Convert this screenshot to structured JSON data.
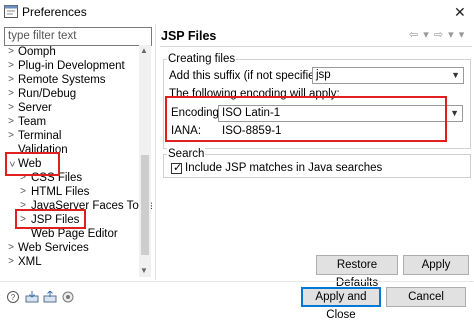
{
  "window": {
    "title": "Preferences"
  },
  "filter": {
    "placeholder": "type filter text"
  },
  "tree": {
    "items": [
      {
        "label": "Oomph"
      },
      {
        "label": "Plug-in Development"
      },
      {
        "label": "Remote Systems"
      },
      {
        "label": "Run/Debug"
      },
      {
        "label": "Server"
      },
      {
        "label": "Team"
      },
      {
        "label": "Terminal"
      },
      {
        "label": "Validation"
      },
      {
        "label": "Web"
      },
      {
        "label": "CSS Files"
      },
      {
        "label": "HTML Files"
      },
      {
        "label": "JavaServer Faces Tools"
      },
      {
        "label": "JSP Files"
      },
      {
        "label": "Web Page Editor"
      },
      {
        "label": "Web Services"
      },
      {
        "label": "XML"
      }
    ]
  },
  "page": {
    "title": "JSP Files",
    "creating_files": {
      "group_label": "Creating files",
      "suffix_label": "Add this suffix (if not specified):",
      "suffix_value": "jsp",
      "encoding_heading": "The following encoding will apply:",
      "encoding_label": "Encoding:",
      "encoding_value": "ISO Latin-1",
      "iana_label": "IANA:",
      "iana_value": "ISO-8859-1"
    },
    "search": {
      "group_label": "Search",
      "include_label": "Include JSP matches in Java searches",
      "include_checked": true
    },
    "restore_defaults": "Restore Defaults",
    "apply": "Apply"
  },
  "footer": {
    "apply_and_close": "Apply and Close",
    "cancel": "Cancel"
  },
  "colors": {
    "highlight_box": "#e02020",
    "default_button_border": "#0078d7"
  }
}
